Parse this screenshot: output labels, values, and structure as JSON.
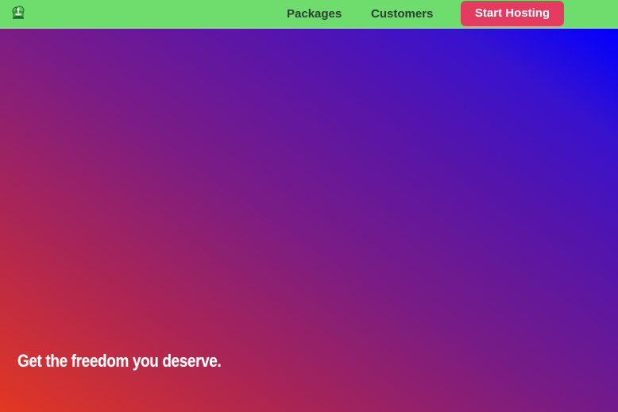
{
  "navbar": {
    "logo_icon": "cloud-server-logo-icon",
    "links": [
      {
        "label": "Packages"
      },
      {
        "label": "Customers"
      }
    ],
    "cta_label": "Start Hosting"
  },
  "hero": {
    "tagline": "Get the freedom you deserve."
  },
  "colors": {
    "nav_background": "#6edd6e",
    "cta_background": "#e63b61",
    "gradient_start": "#e73823",
    "gradient_mid": "#7b1c86",
    "gradient_end": "#0000ff"
  }
}
